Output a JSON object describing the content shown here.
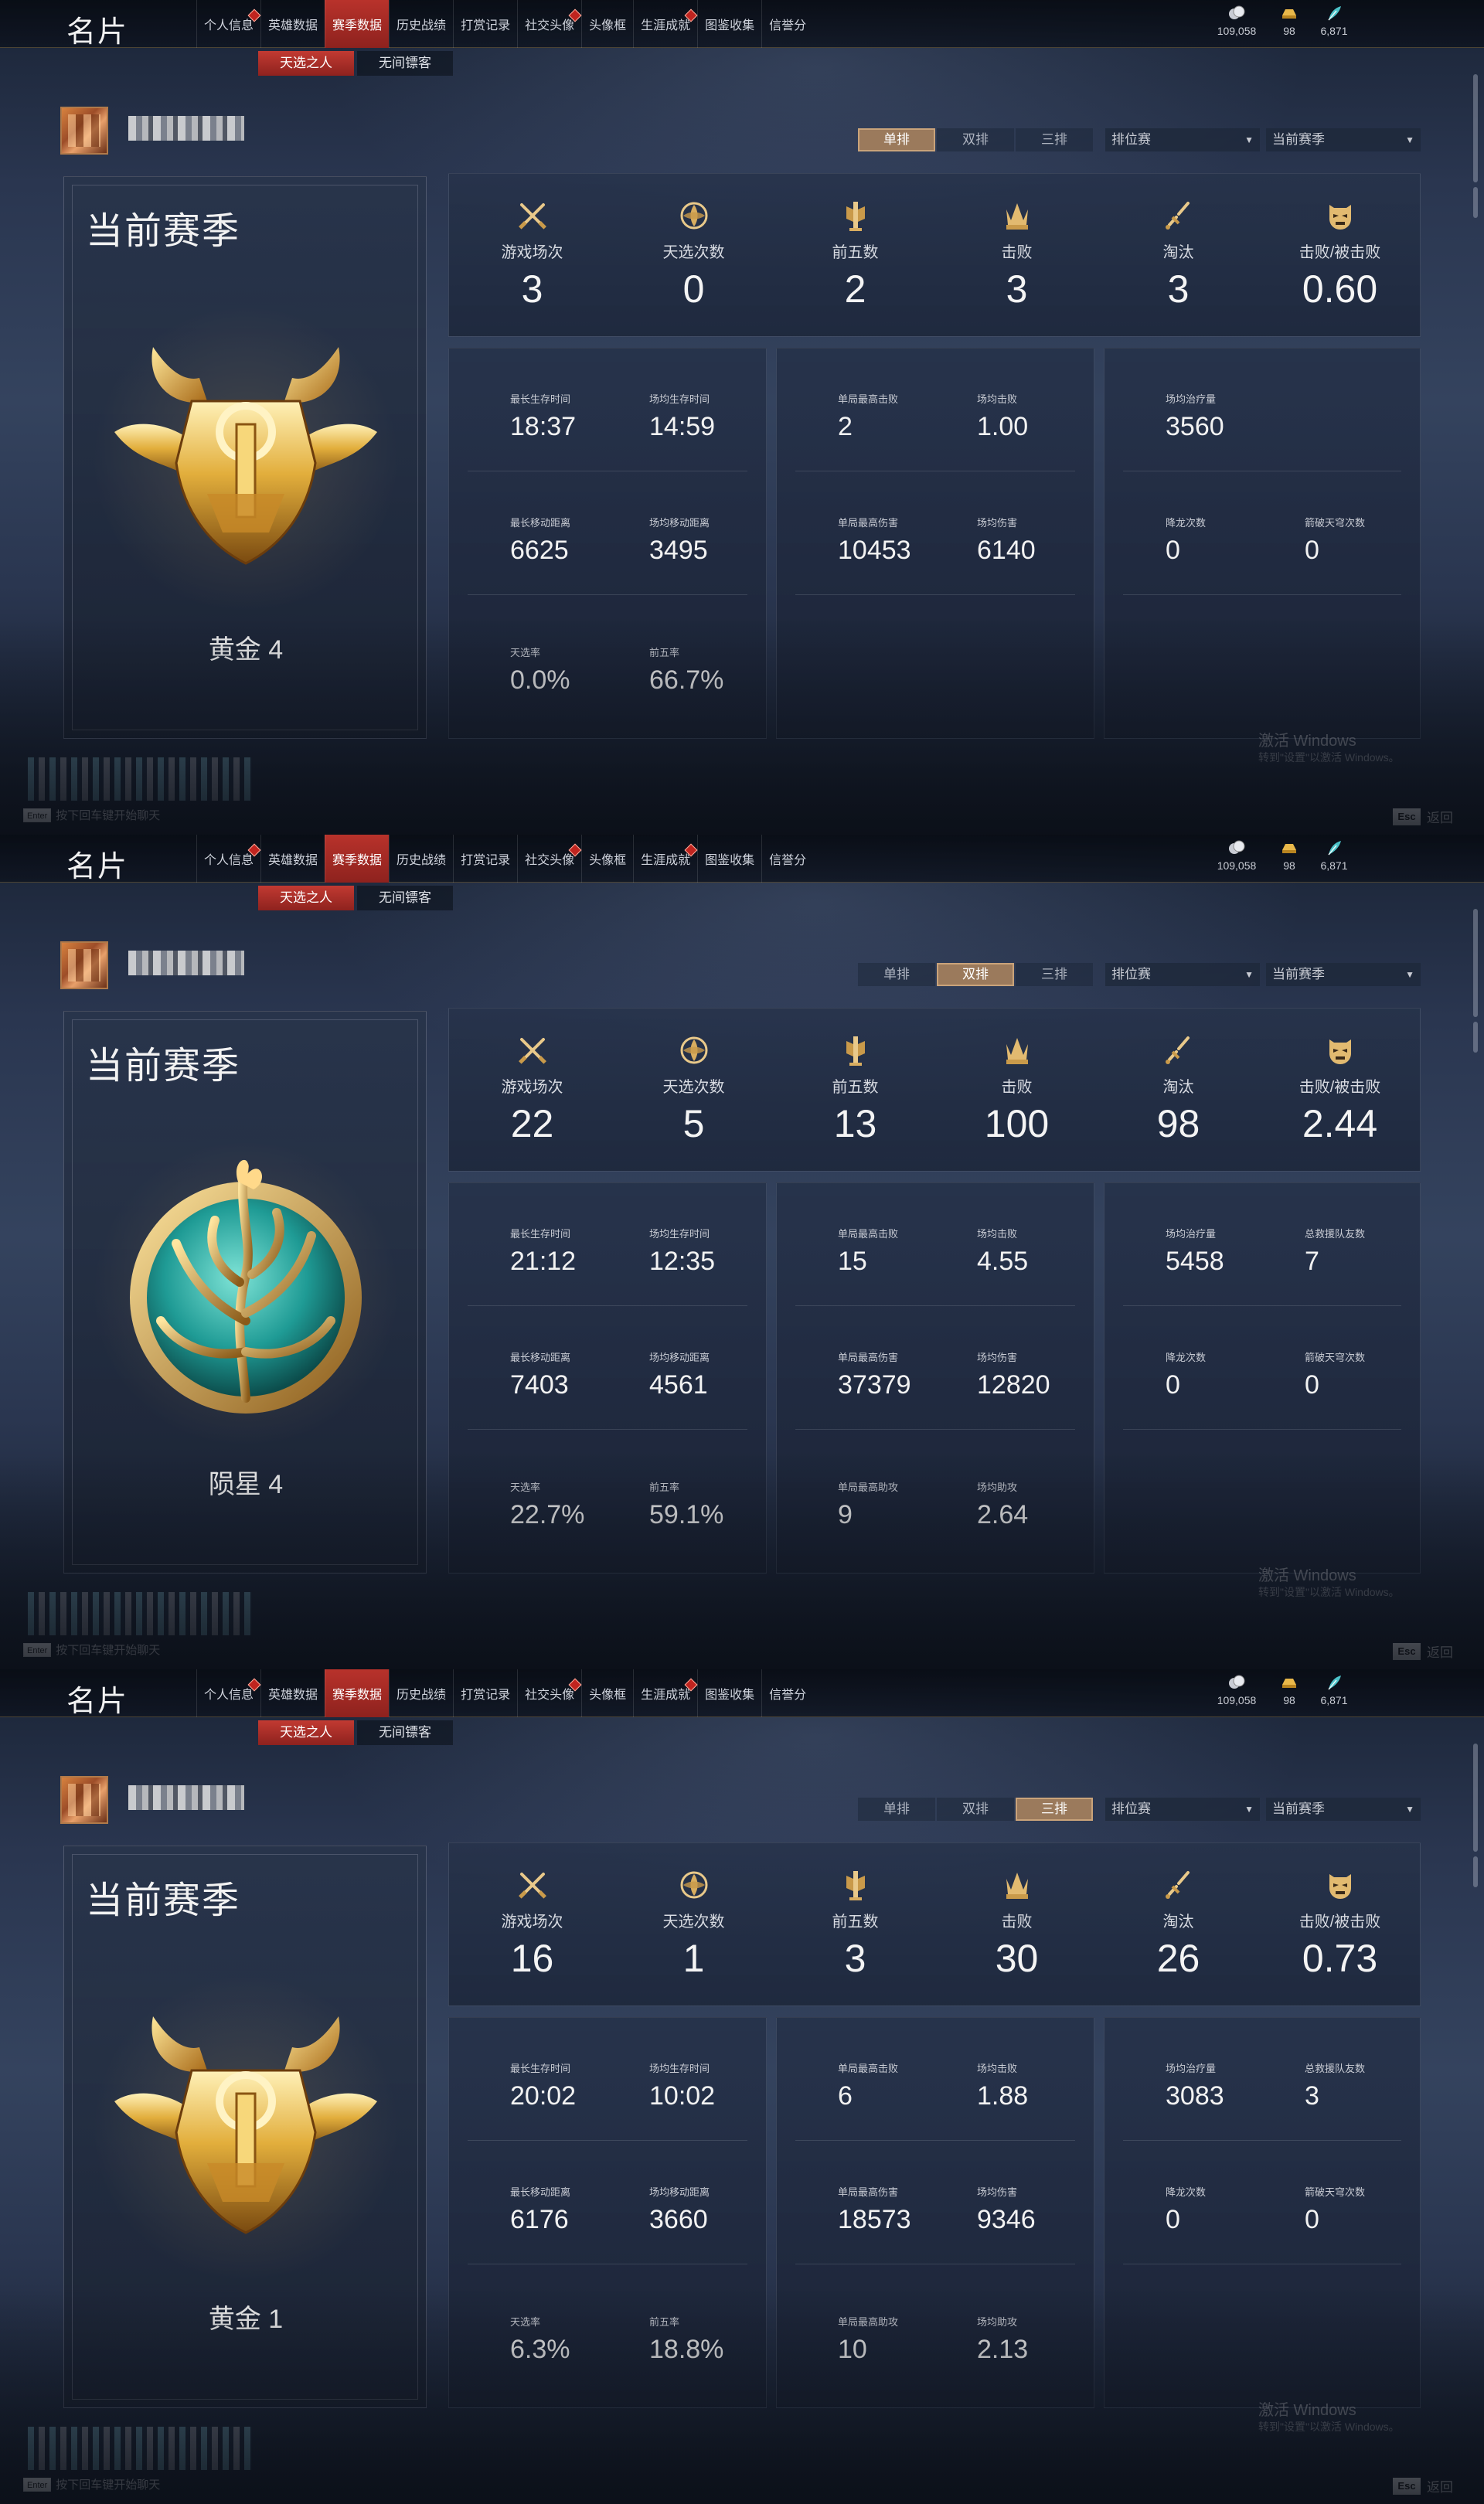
{
  "nav": {
    "app_title": "名片",
    "items": [
      "个人信息",
      "英雄数据",
      "赛季数据",
      "历史战绩",
      "打赏记录",
      "社交头像",
      "头像框",
      "生涯成就",
      "图鉴收集",
      "信誉分"
    ],
    "active_index": 2,
    "badge_indices": [
      0,
      5,
      7
    ]
  },
  "currency": [
    {
      "icon": "coin-icon",
      "value": "109,058"
    },
    {
      "icon": "gold-ingot-icon",
      "value": "98"
    },
    {
      "icon": "feather-icon",
      "value": "6,871"
    }
  ],
  "subtabs": [
    "天选之人",
    "无间镖客"
  ],
  "subtab_active": 0,
  "mode_tabs": [
    "单排",
    "双排",
    "三排"
  ],
  "dropdowns": {
    "type": "排位赛",
    "season": "当前赛季"
  },
  "season_title": "当前赛季",
  "windows_watermark": {
    "line1": "激活 Windows",
    "line2": "转到\"设置\"以激活 Windows。"
  },
  "footer": {
    "enter_key": "Enter",
    "enter_hint": "按下回车键开始聊天",
    "esc_key": "Esc",
    "esc_label": "返回"
  },
  "top_stat_labels": [
    "游戏场次",
    "天选次数",
    "前五数",
    "击败",
    "淘汰",
    "击败/被击败"
  ],
  "top_stat_icons": [
    "crossed-swords-icon",
    "lotus-emblem-icon",
    "banner-top5-icon",
    "trident-crown-icon",
    "broken-sword-icon",
    "demon-mask-icon"
  ],
  "screens": [
    {
      "mode_active": 0,
      "rank_name": "黄金 4",
      "rank_emblem": "gold-horned-emblem-icon",
      "top_stats": [
        "3",
        "0",
        "2",
        "3",
        "3",
        "0.60"
      ],
      "panel1": [
        {
          "label": "最长生存时间",
          "value": "18:37"
        },
        {
          "label": "场均生存时间",
          "value": "14:59"
        },
        {
          "label": "最长移动距离",
          "value": "6625"
        },
        {
          "label": "场均移动距离",
          "value": "3495"
        },
        {
          "label": "天选率",
          "value": "0.0%"
        },
        {
          "label": "前五率",
          "value": "66.7%"
        }
      ],
      "panel2": [
        {
          "label": "单局最高击败",
          "value": "2"
        },
        {
          "label": "场均击败",
          "value": "1.00"
        },
        {
          "label": "单局最高伤害",
          "value": "10453"
        },
        {
          "label": "场均伤害",
          "value": "6140"
        }
      ],
      "panel3": [
        {
          "label": "场均治疗量",
          "value": "3560"
        },
        {
          "label": "降龙次数",
          "value": "0"
        },
        {
          "label": "箭破天穹次数",
          "value": "0"
        }
      ]
    },
    {
      "mode_active": 1,
      "rank_name": "陨星 4",
      "rank_emblem": "meteor-orb-emblem-icon",
      "top_stats": [
        "22",
        "5",
        "13",
        "100",
        "98",
        "2.44"
      ],
      "panel1": [
        {
          "label": "最长生存时间",
          "value": "21:12"
        },
        {
          "label": "场均生存时间",
          "value": "12:35"
        },
        {
          "label": "最长移动距离",
          "value": "7403"
        },
        {
          "label": "场均移动距离",
          "value": "4561"
        },
        {
          "label": "天选率",
          "value": "22.7%"
        },
        {
          "label": "前五率",
          "value": "59.1%"
        }
      ],
      "panel2": [
        {
          "label": "单局最高击败",
          "value": "15"
        },
        {
          "label": "场均击败",
          "value": "4.55"
        },
        {
          "label": "单局最高伤害",
          "value": "37379"
        },
        {
          "label": "场均伤害",
          "value": "12820"
        },
        {
          "label": "单局最高助攻",
          "value": "9"
        },
        {
          "label": "场均助攻",
          "value": "2.64"
        }
      ],
      "panel3": [
        {
          "label": "场均治疗量",
          "value": "5458"
        },
        {
          "label": "总救援队友数",
          "value": "7"
        },
        {
          "label": "降龙次数",
          "value": "0"
        },
        {
          "label": "箭破天穹次数",
          "value": "0"
        }
      ]
    },
    {
      "mode_active": 2,
      "rank_name": "黄金 1",
      "rank_emblem": "gold-horned-emblem-icon",
      "top_stats": [
        "16",
        "1",
        "3",
        "30",
        "26",
        "0.73"
      ],
      "panel1": [
        {
          "label": "最长生存时间",
          "value": "20:02"
        },
        {
          "label": "场均生存时间",
          "value": "10:02"
        },
        {
          "label": "最长移动距离",
          "value": "6176"
        },
        {
          "label": "场均移动距离",
          "value": "3660"
        },
        {
          "label": "天选率",
          "value": "6.3%"
        },
        {
          "label": "前五率",
          "value": "18.8%"
        }
      ],
      "panel2": [
        {
          "label": "单局最高击败",
          "value": "6"
        },
        {
          "label": "场均击败",
          "value": "1.88"
        },
        {
          "label": "单局最高伤害",
          "value": "18573"
        },
        {
          "label": "场均伤害",
          "value": "9346"
        },
        {
          "label": "单局最高助攻",
          "value": "10"
        },
        {
          "label": "场均助攻",
          "value": "2.13"
        }
      ],
      "panel3": [
        {
          "label": "场均治疗量",
          "value": "3083"
        },
        {
          "label": "总救援队友数",
          "value": "3"
        },
        {
          "label": "降龙次数",
          "value": "0"
        },
        {
          "label": "箭破天穹次数",
          "value": "0"
        }
      ]
    }
  ]
}
